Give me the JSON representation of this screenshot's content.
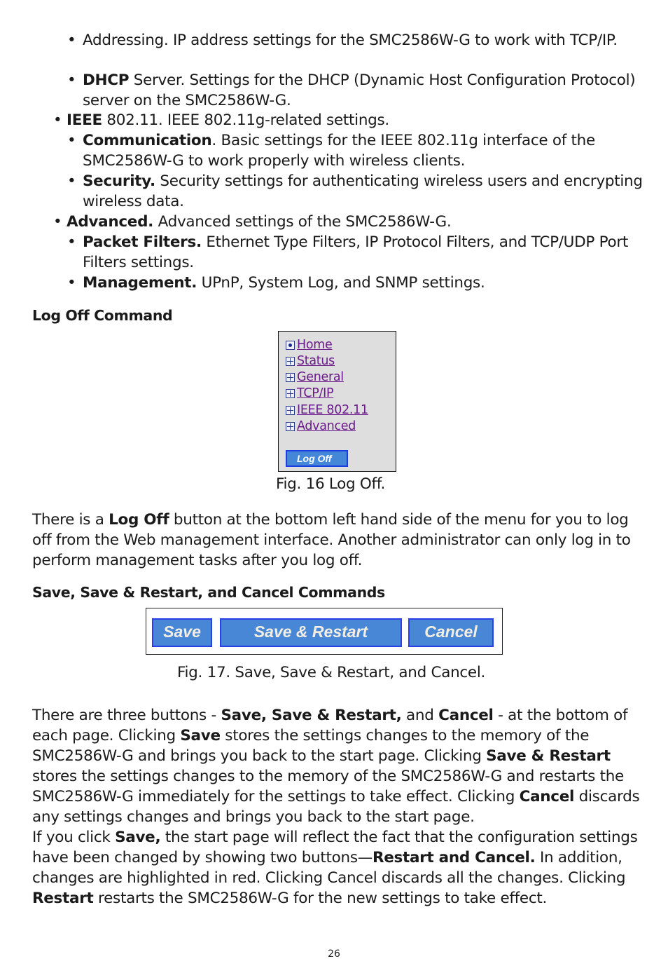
{
  "bullets": [
    {
      "level": 2,
      "bold": "",
      "text": "Addressing. IP address settings for the SMC2586W-G to work with TCP/IP."
    },
    {
      "level": 2,
      "bold": "DHCP",
      "text": " Server. Settings for the DHCP (Dynamic Host Configuration Protocol) server on the SMC2586W-G."
    },
    {
      "level": 1,
      "bold": "IEEE",
      "text": " 802.11. IEEE 802.11g-related settings."
    },
    {
      "level": 2,
      "bold": "Communication",
      "text": ". Basic settings for the IEEE 802.11g interface of the SMC2586W-G to work properly with wireless clients."
    },
    {
      "level": 2,
      "bold": "Security.",
      "text": " Security settings for authenticating wireless users and encrypting wireless data."
    },
    {
      "level": 1,
      "bold": "Advanced.",
      "text": " Advanced settings of the SMC2586W-G."
    },
    {
      "level": 2,
      "bold": "Packet Filters.",
      "text": " Ethernet Type Filters, IP Protocol Filters, and TCP/UDP Port Filters settings."
    },
    {
      "level": 2,
      "bold": "Management.",
      "text": " UPnP, System Log, and SNMP settings."
    }
  ],
  "section_logoff": {
    "heading": "Log Off Command",
    "menu": {
      "items": [
        {
          "label": "Home",
          "icon": "home-radio-icon"
        },
        {
          "label": "Status",
          "icon": "expand-plus-icon"
        },
        {
          "label": "General",
          "icon": "expand-plus-icon"
        },
        {
          "label": "TCP/IP",
          "icon": "expand-plus-icon"
        },
        {
          "label": "IEEE 802.11",
          "icon": "expand-plus-icon"
        },
        {
          "label": "Advanced",
          "icon": "expand-plus-icon"
        }
      ],
      "logoff_label": "Log Off"
    },
    "caption": "Fig. 16 Log Off.",
    "para": {
      "t1": "There is a ",
      "b1": "Log Off",
      "t2": " button at the bottom left hand side of the menu for you to log off from the Web management interface. Another administrator can only log in to perform management tasks after you log off."
    }
  },
  "section_save": {
    "heading": "Save, Save & Restart, and Cancel Commands",
    "buttons": {
      "save": "Save",
      "save_restart": "Save & Restart",
      "cancel": "Cancel"
    },
    "caption": "Fig. 17. Save, Save & Restart, and Cancel.",
    "para1": {
      "t1": "There are three buttons - ",
      "b1": "Save, Save & Restart,",
      "t2": " and ",
      "b2": "Cancel",
      "t3": " - at the bottom of each page. Clicking ",
      "b3": "Save",
      "t4": " stores the settings changes to the memory of the SMC2586W-G and brings you back to the start page. Clicking ",
      "b4": "Save & Restart",
      "t5": " stores the settings changes to the memory of the SMC2586W-G and restarts the SMC2586W-G immediately for the settings to take effect. Clicking ",
      "b5": "Cancel",
      "t6": " discards any settings changes and brings you back to the start page."
    },
    "para2": {
      "t1": "If you click ",
      "b1": "Save,",
      "t2": " the start page will reflect the fact that the configuration settings have been changed by showing two buttons—",
      "b2": "Restart and Cancel.",
      "t3": " In addition, changes are highlighted in red. Clicking Cancel discards all the changes. Clicking ",
      "b3": "Restart",
      "t4": " restarts the SMC2586W-G for the new settings to take effect."
    }
  },
  "page_number": "26"
}
